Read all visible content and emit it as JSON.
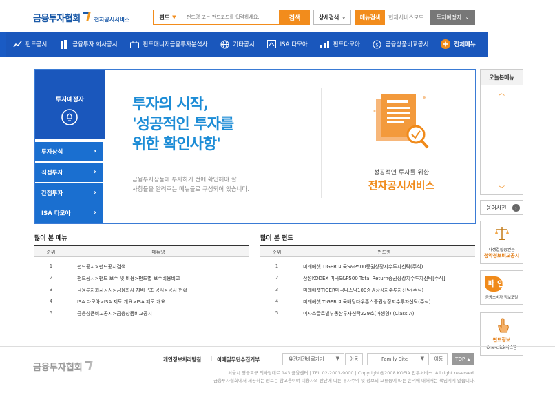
{
  "header": {
    "logo_main": "금융투자협회",
    "logo_sub": "전자공시서비스",
    "search_category": "펀드",
    "search_placeholder": "펀드명 또는 펀드코드를 입력하세요.",
    "search_button": "검색",
    "detail_search": "상세검색",
    "menu_search": "메뉴검색",
    "service_mode": "현재서비스모드",
    "investor_mode": "투자예정자"
  },
  "nav": {
    "items": [
      {
        "label": "펀드공시",
        "icon": "chart-icon"
      },
      {
        "label": "금융투자 회사공시",
        "icon": "building-icon"
      },
      {
        "label": "펀드매니저금융투자분석사",
        "icon": "briefcase-icon"
      },
      {
        "label": "기타공시",
        "icon": "globe-icon"
      },
      {
        "label": "ISA 다모아",
        "icon": "isa-icon"
      },
      {
        "label": "펀드다모아",
        "icon": "bar-chart-icon"
      },
      {
        "label": "금융상품비교공시",
        "icon": "coin-icon"
      },
      {
        "label": "전체메뉴",
        "icon": "plus-icon"
      }
    ]
  },
  "banner": {
    "panel_title": "투자예정자",
    "side_items": [
      "투자상식",
      "직접투자",
      "간접투자",
      "ISA 다모아"
    ],
    "headline": [
      "투자의 시작,",
      "'성공적인 투자를",
      "위한 확인사항'"
    ],
    "desc": [
      "금융투자상품에 투자하기 전에 확인해야 할",
      "사항들을 알려주는 메뉴들로 구성되어 있습니다."
    ],
    "promo_line1": "성공적인 투자를 위한",
    "promo_line2": "전자공시서비스"
  },
  "right": {
    "today_title": "오늘본메뉴",
    "dict": "용어사전",
    "box1_line1": "파생결합증권등",
    "box1_line2": "청약청보비교공시",
    "box2_text": "파 인",
    "box2_sub": "금융소비자 정보포털",
    "box3_line1": "펀드정보",
    "box3_line2": "One-click시스템"
  },
  "popular_menu": {
    "title": "많이 본 메뉴",
    "col_rank": "순위",
    "col_name": "메뉴명",
    "rows": [
      {
        "rank": "1",
        "name": "펀드공시>펀드공시검색"
      },
      {
        "rank": "2",
        "name": "펀드공시>펀드 보수 및 비용>펀드별 보수비용비교"
      },
      {
        "rank": "3",
        "name": "금융투자회사공시>금융회사 지배구조 공시>공시 현황"
      },
      {
        "rank": "4",
        "name": "ISA 다모아>ISA 제도 개요>ISA 제도 개요"
      },
      {
        "rank": "5",
        "name": "금융상품비교공시>금융상품비교공시"
      }
    ]
  },
  "popular_fund": {
    "title": "많이 본 펀드",
    "col_rank": "순위",
    "col_name": "펀드명",
    "rows": [
      {
        "rank": "1",
        "name": "미래에셋 TIGER 미국S&P500증권상장지수투자신탁(주식)"
      },
      {
        "rank": "2",
        "name": "삼성KODEX 미국S&P500 Total Return증권상장지수투자신탁[주식]"
      },
      {
        "rank": "3",
        "name": "미래에셋TIGER미국나스닥100증권상장지수투자신탁(주식)"
      },
      {
        "rank": "4",
        "name": "미래에셋 TIGER 미국배당다우존스증권상장지수투자신탁(주식)"
      },
      {
        "rank": "5",
        "name": "미자스글로벌부동산투자신탁229호(파생형) (Class A)"
      }
    ]
  },
  "footer": {
    "logo": "금융투자협회",
    "privacy": "개인정보처리방침",
    "sep": "|",
    "email_policy": "이메일무단수집거부",
    "related_select": "유관기관바로가기",
    "family_select": "Family Site",
    "go": "이동",
    "top": "TOP",
    "addr1": "서울시 영등포구 의사당대로 143 금융센터 | TEL 02-2003-9000 | Copyright@2008 KOFIA 업무서비스. All right reserved.",
    "addr2": "금융투자협회에서 제공하는 정보는 참고용이며 이용자의 판단에 따른 투자수익 및 정보의 오류등에 따른 손익에 대해서는 책임지지 않습니다."
  }
}
